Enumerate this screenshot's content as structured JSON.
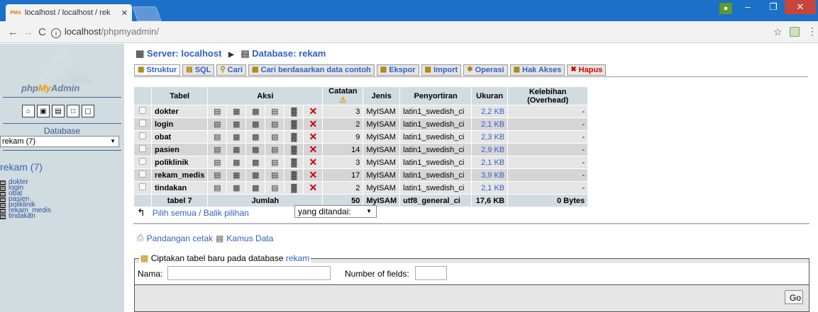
{
  "browser": {
    "tab_title": "localhost / localhost / rek",
    "tab_close": "✕",
    "pma_badge": "PMA",
    "url_host": "localhost",
    "url_path": "/phpmyadmin/"
  },
  "sidebar": {
    "logo_php": "php",
    "logo_my": "My",
    "logo_admin": "Admin",
    "database_label": "Database",
    "database_select": "rekam (7)",
    "db_heading": "rekam (7)",
    "tables": [
      "dokter",
      "login",
      "obat",
      "pasien",
      "poliklinik",
      "rekam_medis",
      "tindakan"
    ]
  },
  "breadcrumb": {
    "server": "Server: localhost",
    "database": "Database: rekam"
  },
  "tabs": [
    "Struktur",
    "SQL",
    "Cari",
    "Cari berdasarkan data contoh",
    "Ekspor",
    "Import",
    "Operasi",
    "Hak Akses",
    "Hapus"
  ],
  "table": {
    "headers": {
      "tabel": "Tabel",
      "aksi": "Aksi",
      "catatan": "Catatan",
      "jenis": "Jenis",
      "penyortiran": "Penyortiran",
      "ukuran": "Ukuran",
      "kelebihan": "Kelebihan (Overhead)"
    },
    "rows": [
      {
        "name": "dokter",
        "records": "3",
        "engine": "MyISAM",
        "collation": "latin1_swedish_ci",
        "size": "2,2 KB",
        "overhead": "-"
      },
      {
        "name": "login",
        "records": "2",
        "engine": "MyISAM",
        "collation": "latin1_swedish_ci",
        "size": "2,1 KB",
        "overhead": "-"
      },
      {
        "name": "obat",
        "records": "9",
        "engine": "MyISAM",
        "collation": "latin1_swedish_ci",
        "size": "2,3 KB",
        "overhead": "-"
      },
      {
        "name": "pasien",
        "records": "14",
        "engine": "MyISAM",
        "collation": "latin1_swedish_ci",
        "size": "2,9 KB",
        "overhead": "-"
      },
      {
        "name": "poliklinik",
        "records": "3",
        "engine": "MyISAM",
        "collation": "latin1_swedish_ci",
        "size": "2,1 KB",
        "overhead": "-"
      },
      {
        "name": "rekam_medis",
        "records": "17",
        "engine": "MyISAM",
        "collation": "latin1_swedish_ci",
        "size": "3,9 KB",
        "overhead": "-"
      },
      {
        "name": "tindakan",
        "records": "2",
        "engine": "MyISAM",
        "collation": "latin1_swedish_ci",
        "size": "2,1 KB",
        "overhead": "-"
      }
    ],
    "footer": {
      "count": "tabel 7",
      "sum_label": "Jumlah",
      "records": "50",
      "engine": "MyISAM",
      "collation": "utf8_general_ci",
      "size": "17,6 KB",
      "overhead": "0 Bytes"
    }
  },
  "selection": {
    "check_all": "Pilih semua",
    "separator": " / ",
    "uncheck": "Balik pilihan",
    "with_selected": "yang ditandai:"
  },
  "links": {
    "print": "Pandangan cetak",
    "dictionary": "Kamus Data"
  },
  "create_table": {
    "legend": "Ciptakan tabel baru pada database",
    "db_link": "rekam",
    "name_label": "Nama:",
    "fields_label": "Number of fields:",
    "go_button": "Go"
  }
}
